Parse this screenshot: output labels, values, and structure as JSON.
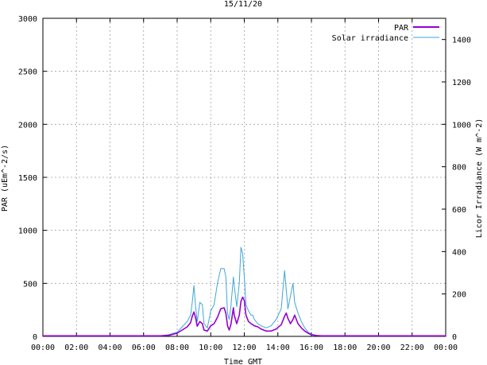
{
  "chart_data": {
    "type": "line",
    "title": "15/11/20",
    "xlabel": "Time GMT",
    "ylabel": "PAR (uEm^-2/s)",
    "y2label": "Licor Irradiance (W m^-2)",
    "x_ticks": [
      "00:00",
      "02:00",
      "04:00",
      "06:00",
      "08:00",
      "10:00",
      "12:00",
      "14:00",
      "16:00",
      "18:00",
      "20:00",
      "22:00",
      "00:00"
    ],
    "xlim_hours": [
      0,
      24
    ],
    "ylim": [
      0,
      3000
    ],
    "y_ticks": [
      "0",
      "500",
      "1000",
      "1500",
      "2000",
      "2500",
      "3000"
    ],
    "y2lim": [
      0,
      1500
    ],
    "y2_ticks": [
      "0",
      "200",
      "400",
      "600",
      "800",
      "1000",
      "1200",
      "1400"
    ],
    "grid": true,
    "legend_position": "top-right",
    "series": [
      {
        "name": "PAR",
        "axis": "left",
        "color": "#9400d3",
        "x_hours": [
          0,
          7.0,
          7.5,
          8.0,
          8.3,
          8.6,
          8.8,
          8.9,
          9.0,
          9.1,
          9.2,
          9.35,
          9.5,
          9.6,
          9.8,
          10.0,
          10.2,
          10.4,
          10.6,
          10.8,
          10.9,
          11.0,
          11.1,
          11.2,
          11.35,
          11.4,
          11.55,
          11.7,
          11.8,
          11.9,
          12.0,
          12.1,
          12.25,
          12.4,
          12.5,
          12.6,
          12.8,
          13.0,
          13.3,
          13.6,
          13.9,
          14.2,
          14.4,
          14.5,
          14.6,
          14.75,
          14.9,
          15.0,
          15.2,
          15.4,
          15.6,
          15.8,
          16.0,
          16.3,
          16.6,
          17.0,
          24
        ],
        "values": [
          5,
          5,
          10,
          30,
          60,
          90,
          130,
          190,
          230,
          175,
          95,
          140,
          120,
          60,
          50,
          100,
          120,
          180,
          260,
          270,
          220,
          100,
          60,
          110,
          270,
          200,
          120,
          200,
          330,
          370,
          340,
          200,
          140,
          120,
          110,
          100,
          90,
          70,
          50,
          50,
          70,
          110,
          190,
          220,
          170,
          120,
          160,
          200,
          120,
          80,
          50,
          30,
          15,
          8,
          5,
          5,
          5
        ]
      },
      {
        "name": "Solar irradiance",
        "axis": "right",
        "color": "#3ea6d6",
        "x_hours": [
          0,
          7.0,
          7.5,
          8.0,
          8.3,
          8.6,
          8.8,
          8.9,
          9.0,
          9.1,
          9.2,
          9.35,
          9.5,
          9.6,
          9.8,
          10.0,
          10.2,
          10.4,
          10.6,
          10.7,
          10.8,
          10.9,
          11.0,
          11.1,
          11.2,
          11.35,
          11.4,
          11.55,
          11.7,
          11.8,
          11.9,
          12.0,
          12.1,
          12.25,
          12.4,
          12.5,
          12.6,
          12.8,
          13.0,
          13.3,
          13.6,
          13.9,
          14.2,
          14.4,
          14.5,
          14.6,
          14.75,
          14.9,
          15.0,
          15.2,
          15.4,
          15.6,
          15.8,
          16.0,
          16.3,
          16.6,
          17.0,
          24
        ],
        "values": [
          3,
          3,
          8,
          20,
          45,
          70,
          100,
          160,
          240,
          140,
          70,
          160,
          150,
          60,
          40,
          120,
          150,
          250,
          320,
          320,
          320,
          280,
          110,
          80,
          140,
          280,
          240,
          140,
          250,
          420,
          390,
          280,
          150,
          120,
          100,
          100,
          80,
          60,
          50,
          40,
          50,
          80,
          130,
          310,
          220,
          130,
          190,
          250,
          160,
          110,
          70,
          40,
          20,
          10,
          5,
          3,
          3,
          3
        ]
      }
    ]
  }
}
